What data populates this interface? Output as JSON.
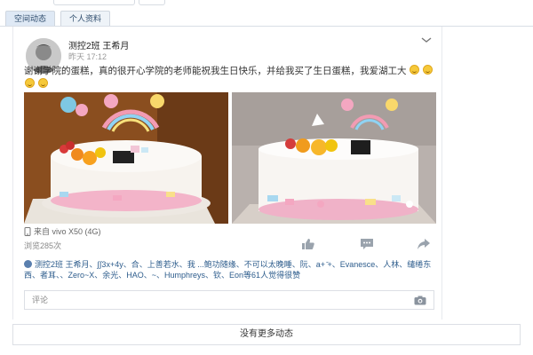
{
  "tabs": [
    {
      "label": "空间动态",
      "active": true
    },
    {
      "label": "个人资料",
      "active": false
    }
  ],
  "post": {
    "author": "测控2班 王希月",
    "time": "昨天 17:12",
    "text": "谢谢学院的蛋糕，真的很开心学院的老师能祝我生日快乐，并给我买了生日蛋糕，我爱湖工大",
    "emoji_count": 4,
    "device": "来自 vivo X50 (4G)",
    "views": "浏览285次",
    "likes_text": "测控2班 王希月、∫∫3x+4y、合、上善若水、我 ...鲍功随缘、不可以太晚睡、阮、a+ ̄+、Evanesce、人林、缱绻东西、者耳、、Zero~X、余光、HAO、~、Humphreys、钦、Eon等61人觉得很赞",
    "comment_placeholder": "评论"
  },
  "icons": {
    "chevron": "chevron-down-icon",
    "device": "phone-icon",
    "like": "thumbs-up-icon",
    "comment": "comment-icon",
    "share": "share-icon",
    "camera": "camera-icon",
    "like_heart": "heart-icon"
  },
  "footer": {
    "more_label": "没有更多动态"
  },
  "colors": {
    "link": "#2d5c8c",
    "tab_bg": "#dfe9f5"
  }
}
